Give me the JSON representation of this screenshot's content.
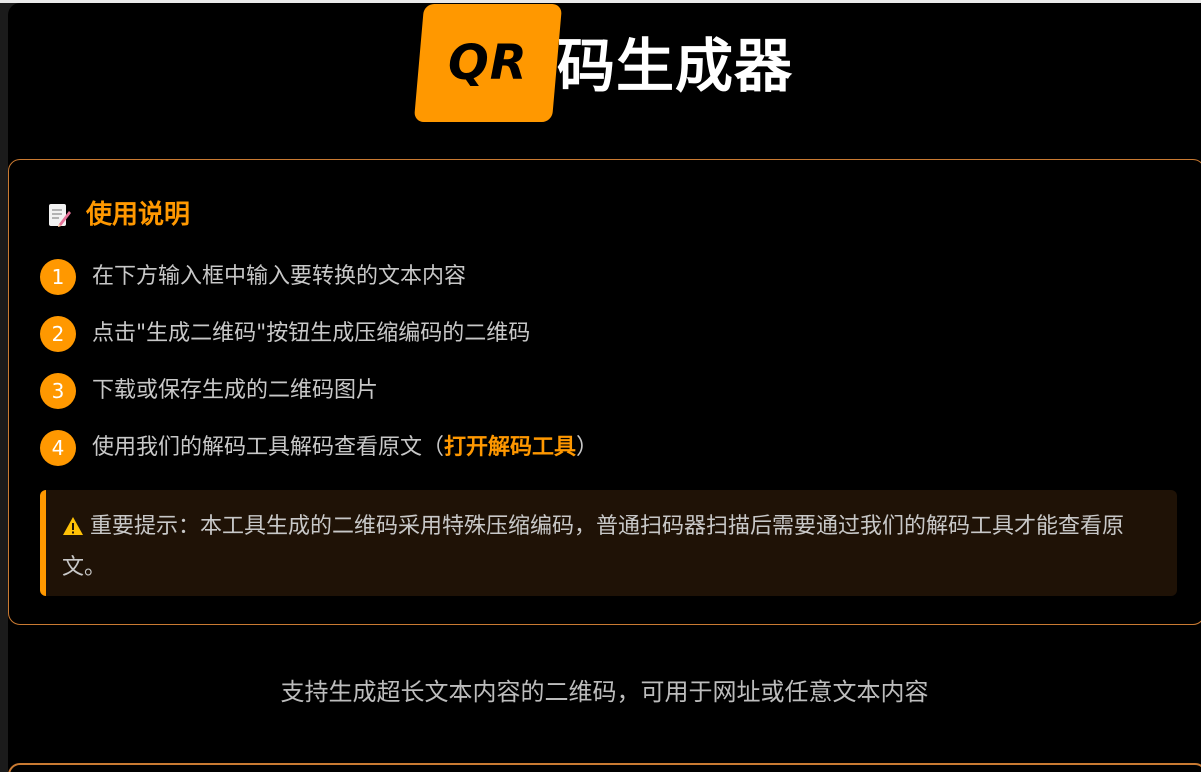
{
  "header": {
    "logo_text": "QR",
    "title": "码生成器"
  },
  "instructions": {
    "heading_icon": "memo-icon",
    "heading": "使用说明",
    "steps": [
      {
        "num": "1",
        "text": "在下方输入框中输入要转换的文本内容"
      },
      {
        "num": "2",
        "text": "点击\"生成二维码\"按钮生成压缩编码的二维码"
      },
      {
        "num": "3",
        "text": "下载或保存生成的二维码图片"
      },
      {
        "num": "4",
        "text": "使用我们的解码工具解码查看原文（",
        "link": "打开解码工具",
        "suffix": "）"
      }
    ],
    "warning": {
      "icon": "warning-icon",
      "text": "重要提示：本工具生成的二维码采用特殊压缩编码，普通扫码器扫描后需要通过我们的解码工具才能查看原文。"
    }
  },
  "subtitle": "支持生成超长文本内容的二维码，可用于网址或任意文本内容",
  "colors": {
    "accent": "#ff9800",
    "background": "#000000",
    "text": "#c8c8c8",
    "warning_bg": "#1f1206"
  }
}
